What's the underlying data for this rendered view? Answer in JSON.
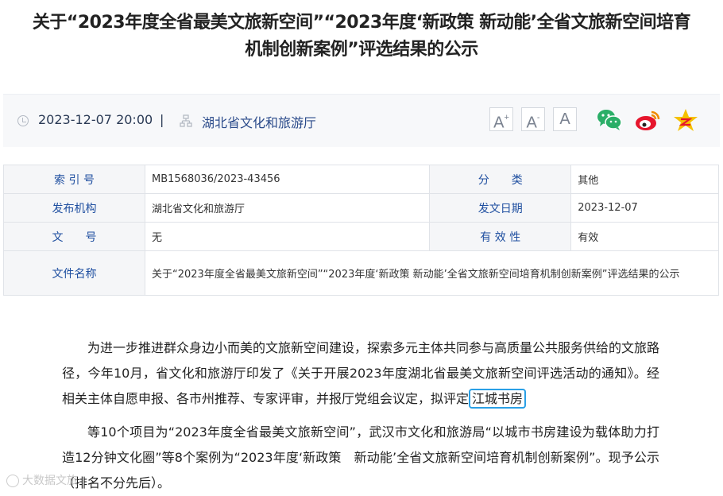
{
  "article": {
    "title_line1": "关于“2023年度全省最美文旅新空间”“2023年度‘新政策 新动能’全省文旅新空间培育",
    "title_line2": "机制创新案例”评选结果的公示"
  },
  "meta": {
    "date": "2023-12-07 20:00",
    "separator": "|",
    "org": "湖北省文化和旅游厅",
    "date_icon": "clock-icon",
    "org_icon": "org-chart-icon",
    "font_large": "A",
    "font_large_mark": "+",
    "font_small": "A",
    "font_small_mark": "-",
    "font_reset": "A",
    "share_icons": [
      "wechat-icon",
      "weibo-icon",
      "qzone-icon"
    ]
  },
  "info_table": {
    "rows": [
      {
        "label1": "索 引 号",
        "value1": "MB1568036/2023-43456",
        "label2": "分　　类",
        "value2": "其他"
      },
      {
        "label1": "发布机构",
        "value1": "湖北省文化和旅游厅",
        "label2": "发文日期",
        "value2": "2023-12-07"
      },
      {
        "label1": "文　　号",
        "value1": "无",
        "label2": "有 效 性",
        "value2": "有效"
      }
    ],
    "filename_label": "文件名称",
    "filename_value": "关于“2023年度全省最美文旅新空间”“2023年度‘新政策 新动能’全省文旅新空间培育机制创新案例”评选结果的公示"
  },
  "body": {
    "para1_before": "为进一步推进群众身边小而美的文旅新空间建设，探索多元主体共同参与高质量公共服务供给的文旅路径，今年10月，省文化和旅游厅印发了《关于开展2023年度湖北省最美文旅新空间评选活动的通知》。经相关主体自愿申报、各市州推荐、专家评审，并报厅党组会议定，拟评定",
    "para1_highlight": "江城书房",
    "para2": "等10个项目为“2023年度全省最美文旅新空间”，武汉市文化和旅游局“以城市书房建设为载体助力打造12分钟文化圈”等8个案例为“2023年度‘新政策　新动能’全省文旅新空间培育机制创新案例”。现予公示（排名不分先后）。"
  },
  "watermark": {
    "text": "大数据文旅"
  },
  "colors": {
    "accent": "#1f4fa0",
    "highlight_border": "#2aa0e6",
    "wechat": "#2aae67",
    "weibo": "#e6162d",
    "qzone": "#f5c100"
  }
}
